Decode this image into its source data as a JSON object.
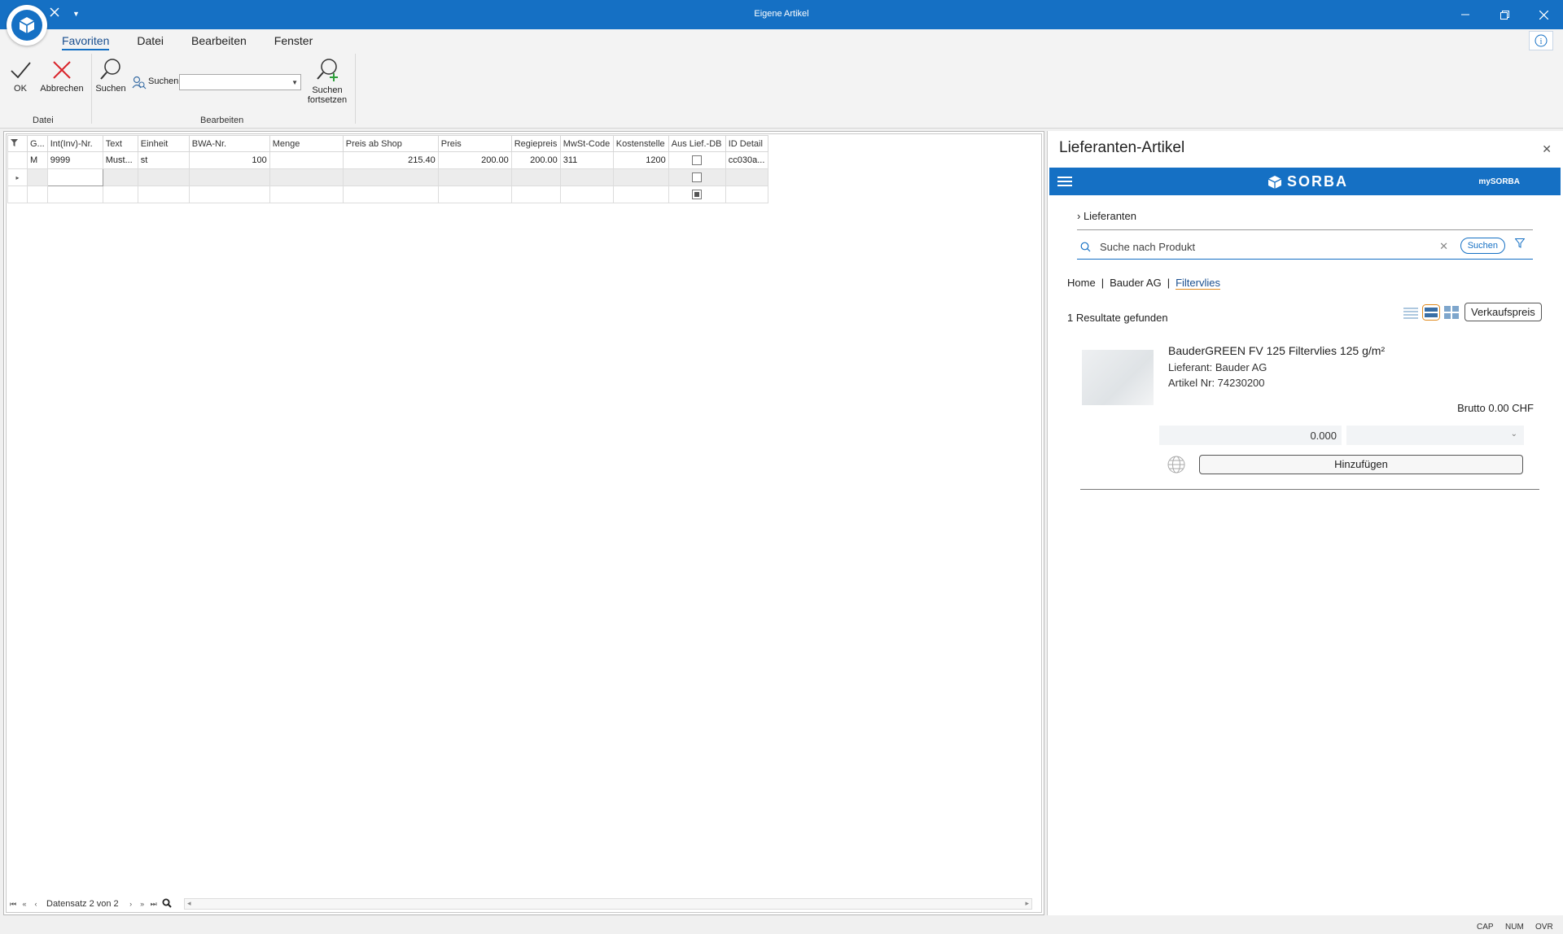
{
  "window": {
    "title": "Eigene Artikel",
    "minimize_glyph": "–",
    "close_glyph": "✕"
  },
  "ribbon": {
    "tabs": [
      "Favoriten",
      "Datei",
      "Bearbeiten",
      "Fenster"
    ],
    "active_tab": "Favoriten",
    "ok_label": "OK",
    "cancel_label": "Abbrechen",
    "suchen_label": "Suchen",
    "search_field_label": "Suchen",
    "search_field_value": "",
    "continue_label_1": "Suchen",
    "continue_label_2": "fortsetzen",
    "group_datei": "Datei",
    "group_bearbeiten": "Bearbeiten",
    "info_glyph": "i"
  },
  "grid": {
    "columns": [
      "G...",
      "Int(Inv)-Nr.",
      "Text",
      "Einheit",
      "BWA-Nr.",
      "Menge",
      "Preis ab Shop",
      "Preis",
      "Regiepreis",
      "MwSt-Code",
      "Kostenstelle",
      "Aus Lief.-DB",
      "ID Detail"
    ],
    "rows": [
      {
        "g": "M",
        "nr": "9999",
        "text": "Must...",
        "einheit": "st",
        "bwa": "100",
        "menge": "",
        "preis_shop": "215.40",
        "preis": "200.00",
        "regie": "200.00",
        "mwst": "311",
        "kst": "1200",
        "aus_lief": false,
        "id": "cc030a..."
      }
    ],
    "new_row_indicator": "▸",
    "record_label": "Datensatz 2 von 2"
  },
  "side_panel": {
    "title": "Lieferanten-Artikel",
    "close_glyph": "✕",
    "brand": "SORBA",
    "mysorba": "mySORBA",
    "nav_link": "Lieferanten",
    "search_placeholder": "Suche nach Produkt",
    "search_clear": "✕",
    "search_button": "Suchen",
    "breadcrumb": [
      "Home",
      "Bauder AG",
      "Filtervlies"
    ],
    "breadcrumb_sep": "|",
    "results_text": "1 Resultate gefunden",
    "sell_price_button": "Verkaufspreis",
    "product": {
      "name": "BauderGREEN FV 125 Filtervlies 125 g/m²",
      "supplier": "Lieferant: Bauder AG",
      "article_no": "Artikel Nr: 74230200",
      "brutto": "Brutto 0.00 CHF",
      "quantity": "0.000",
      "unit": "",
      "add_button": "Hinzufügen"
    }
  },
  "status": {
    "cap": "CAP",
    "num": "NUM",
    "ovr": "OVR"
  },
  "colors": {
    "brand_blue": "#1570c4",
    "accent_orange": "#e08a1e"
  }
}
